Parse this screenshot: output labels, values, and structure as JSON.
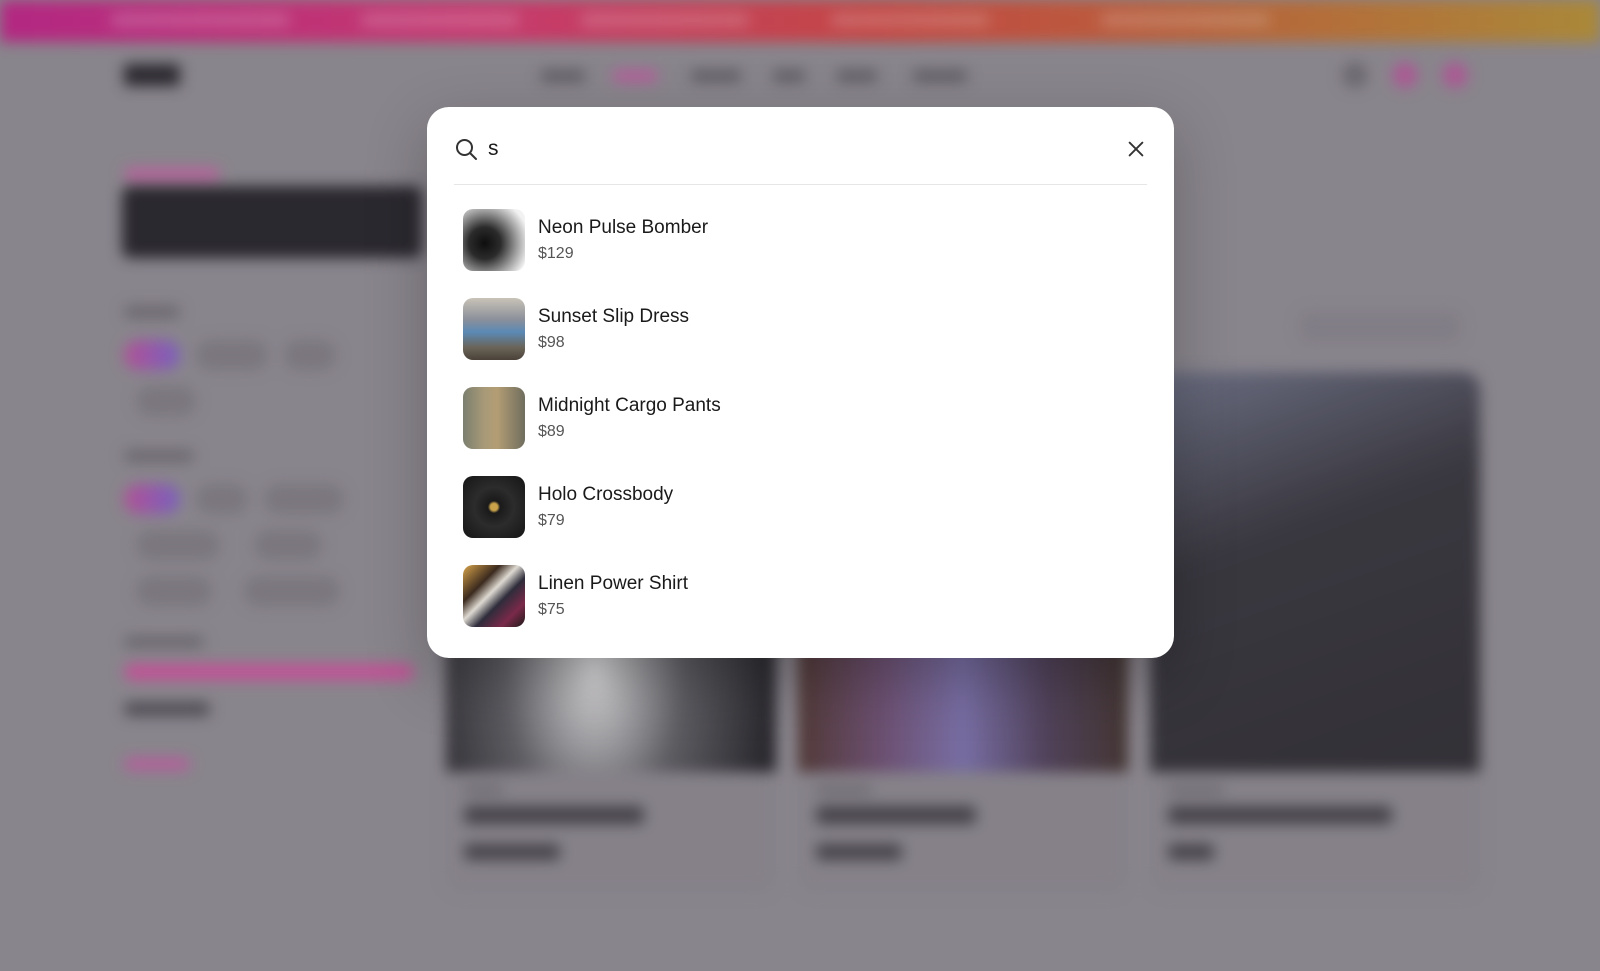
{
  "search": {
    "query": "s",
    "placeholder": ""
  },
  "results": [
    {
      "name": "Neon Pulse Bomber",
      "price": "$129",
      "thumb_icon": "black-bomber-jacket"
    },
    {
      "name": "Sunset Slip Dress",
      "price": "$98",
      "thumb_icon": "denim-dress-outfit"
    },
    {
      "name": "Midnight Cargo Pants",
      "price": "$89",
      "thumb_icon": "khaki-cargo-pants"
    },
    {
      "name": "Holo Crossbody",
      "price": "$79",
      "thumb_icon": "quilted-black-crossbody-bag"
    },
    {
      "name": "Linen Power Shirt",
      "price": "$75",
      "thumb_icon": "folded-shirts"
    }
  ],
  "colors": {
    "promo_gradient": [
      "#c21a86",
      "#d92f6e",
      "#d6403a",
      "#c8612e",
      "#b7902c"
    ],
    "accent": "#d54c9e",
    "modal_bg": "#ffffff"
  }
}
